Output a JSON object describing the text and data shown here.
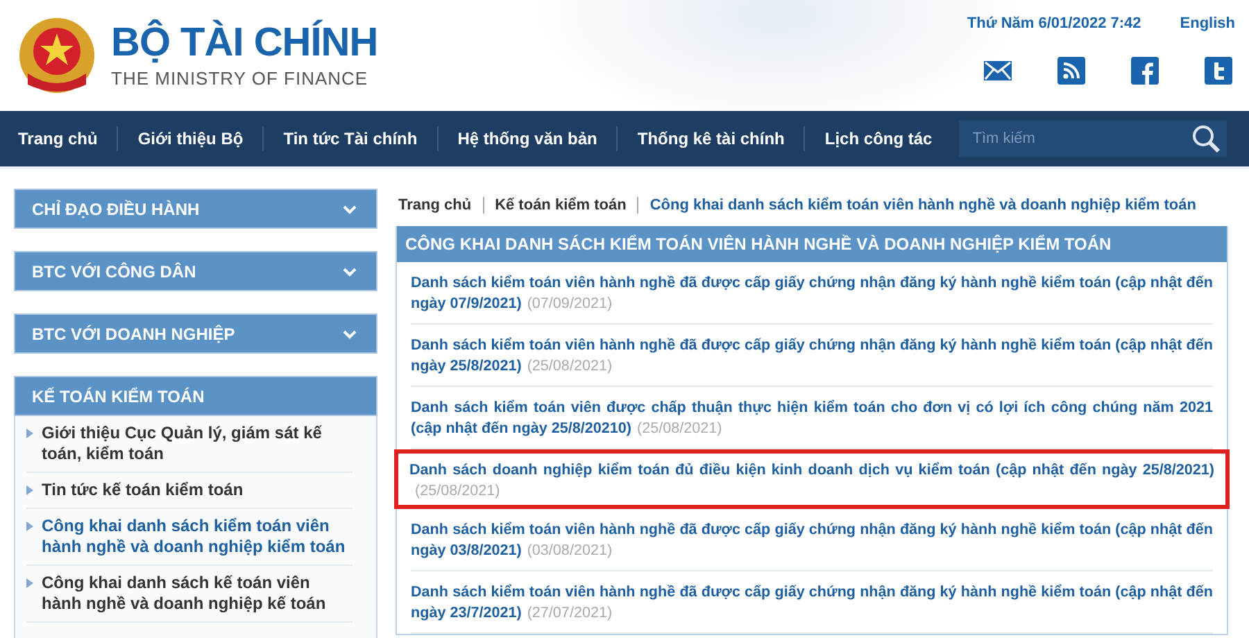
{
  "header": {
    "title": "BỘ TÀI CHÍNH",
    "subtitle": "THE MINISTRY OF FINANCE",
    "datetime": "Thứ Năm 6/01/2022 7:42",
    "language_link": "English",
    "social": [
      {
        "kind": "mail"
      },
      {
        "kind": "rss"
      },
      {
        "kind": "facebook"
      },
      {
        "kind": "twitter"
      }
    ]
  },
  "nav": {
    "items": [
      "Trang chủ",
      "Giới thiệu Bộ",
      "Tin tức Tài chính",
      "Hệ thống văn bản",
      "Thống kê tài chính",
      "Lịch công tác"
    ],
    "search": {
      "placeholder": "Tìm kiếm"
    }
  },
  "sidebar": {
    "sections": [
      {
        "title": "CHỈ ĐẠO ĐIỀU HÀNH",
        "expanded": false
      },
      {
        "title": "BTC VỚI CÔNG DÂN",
        "expanded": false
      },
      {
        "title": "BTC VỚI DOANH NGHIỆP",
        "expanded": false
      },
      {
        "title": "KẾ TOÁN KIỂM TOÁN",
        "expanded": true,
        "items": [
          {
            "label": "Giới thiệu Cục Quản lý, giám sát kế toán, kiểm toán",
            "selected": false
          },
          {
            "label": "Tin tức kế toán kiểm toán",
            "selected": false
          },
          {
            "label": "Công khai danh sách kiểm toán viên hành nghề và doanh nghiệp kiểm toán",
            "selected": true
          },
          {
            "label": "Công khai danh sách kế toán viên hành nghề và doanh nghiệp kế toán",
            "selected": false
          }
        ]
      }
    ]
  },
  "breadcrumb": [
    "Trang chủ",
    "Kế toán kiểm toán",
    "Công khai danh sách kiểm toán viên hành nghề và doanh nghiệp kiểm toán"
  ],
  "panel": {
    "title": "CÔNG KHAI DANH SÁCH KIỂM TOÁN VIÊN HÀNH NGHỀ VÀ DOANH NGHIỆP KIỂM TOÁN",
    "articles": [
      {
        "title": "Danh sách kiểm toán viên hành nghề đã được cấp giấy chứng nhận đăng ký hành nghề kiểm toán (cập nhật đến ngày 07/9/2021)",
        "date": "(07/09/2021)",
        "highlighted": false
      },
      {
        "title": "Danh sách kiểm toán viên hành nghề đã được cấp giấy chứng nhận đăng ký hành nghề kiểm toán (cập nhật đến ngày 25/8/2021)",
        "date": "(25/08/2021)",
        "highlighted": false
      },
      {
        "title": "Danh sách kiểm toán viên được chấp thuận thực hiện kiểm toán cho đơn vị có lợi ích công chúng năm 2021 (cập nhật đến ngày 25/8/20210)",
        "date": "(25/08/2021)",
        "highlighted": false
      },
      {
        "title": "Danh sách doanh nghiệp kiểm toán đủ điều kiện kinh doanh dịch vụ kiểm toán (cập nhật đến ngày 25/8/2021)",
        "date": "(25/08/2021)",
        "highlighted": true
      },
      {
        "title": "Danh sách kiểm toán viên hành nghề đã được cấp giấy chứng nhận đăng ký hành nghề kiểm toán (cập nhật đến ngày 03/8/2021)",
        "date": "(03/08/2021)",
        "highlighted": false
      },
      {
        "title": "Danh sách kiểm toán viên hành nghề đã được cấp giấy chứng nhận đăng ký hành nghề kiểm toán (cập nhật đến ngày 23/7/2021)",
        "date": "(27/07/2021)",
        "highlighted": false
      }
    ]
  }
}
